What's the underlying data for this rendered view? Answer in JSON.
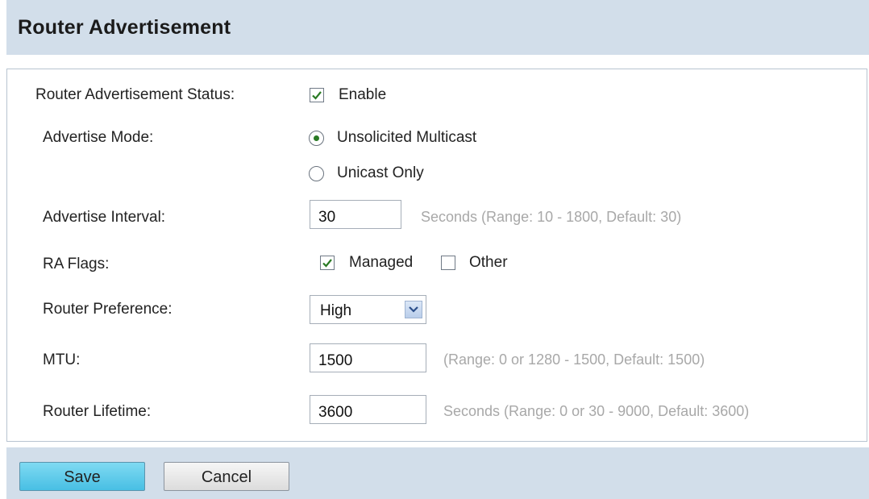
{
  "header": {
    "title": "Router Advertisement"
  },
  "status": {
    "label": "Router Advertisement Status:",
    "enable_label": "Enable",
    "enabled": true
  },
  "mode": {
    "label": "Advertise Mode:",
    "options": [
      {
        "label": "Unsolicited Multicast",
        "selected": true
      },
      {
        "label": "Unicast Only",
        "selected": false
      }
    ]
  },
  "interval": {
    "label": "Advertise Interval:",
    "value": "30",
    "hint": "Seconds (Range: 10 - 1800, Default: 30)"
  },
  "flags": {
    "label": "RA Flags:",
    "managed_label": "Managed",
    "managed": true,
    "other_label": "Other",
    "other": false
  },
  "preference": {
    "label": "Router Preference:",
    "value": "High"
  },
  "mtu": {
    "label": "MTU:",
    "value": "1500",
    "hint": "(Range: 0 or 1280 - 1500, Default: 1500)"
  },
  "lifetime": {
    "label": "Router Lifetime:",
    "value": "3600",
    "hint": "Seconds (Range: 0 or 30 - 9000, Default: 3600)"
  },
  "buttons": {
    "save_label": "Save",
    "cancel_label": "Cancel"
  },
  "colors": {
    "header_bg": "#d2deea",
    "check_green": "#2a7a24",
    "save_blue": "#48bfe4"
  }
}
